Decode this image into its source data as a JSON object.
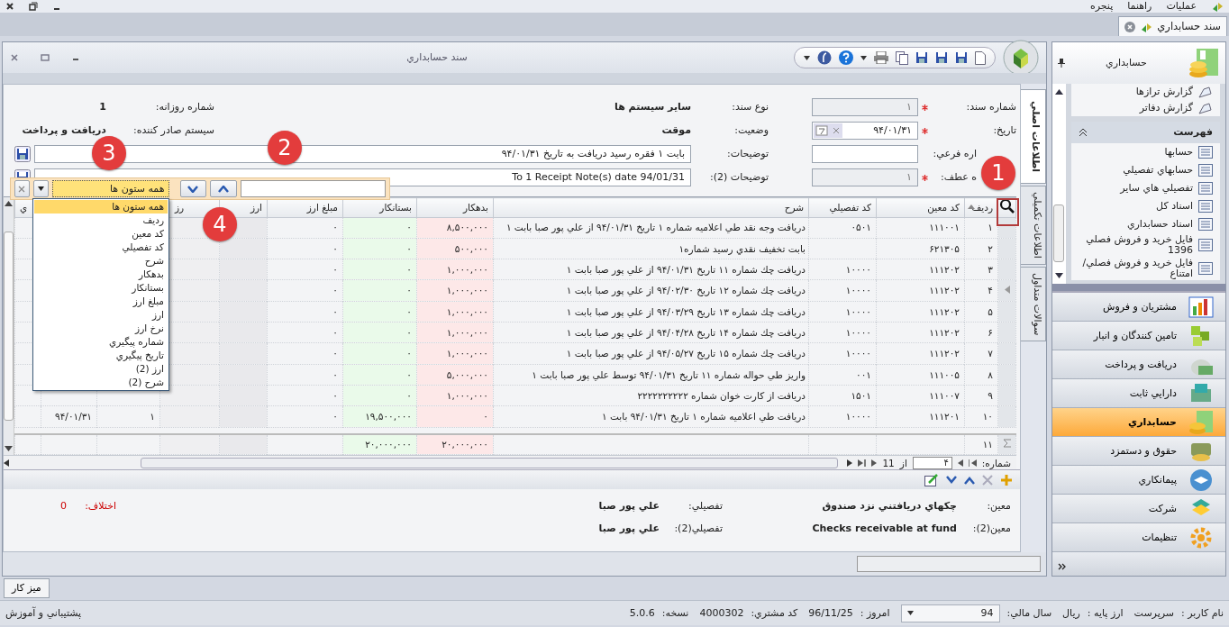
{
  "menubar": {
    "items": [
      "عمليات",
      "راهنما",
      "پنجره"
    ]
  },
  "doc_tabs": [
    {
      "label": "سند حسابداري",
      "selected": true
    }
  ],
  "window": {
    "title": "سند حسابداري"
  },
  "form": {
    "right": [
      {
        "label": "شماره سند:",
        "required": true,
        "value": "۱",
        "disabled": true,
        "kind": "field"
      },
      {
        "label": "تاريخ:",
        "required": true,
        "value": "۹۴/۰۱/۳۱",
        "disabled": false,
        "kind": "date"
      },
      {
        "label": "اره فرعي:",
        "required": false,
        "disabled": false,
        "kind": "field"
      },
      {
        "label": "ه عطف:",
        "required": true,
        "value": "۱",
        "disabled": true,
        "kind": "field"
      }
    ],
    "middle": [
      {
        "label": "نوع سند:",
        "value": "ساير سيستم ها",
        "kind": "text"
      },
      {
        "label": "وضعيت:",
        "value": "موقت",
        "kind": "text"
      },
      {
        "label": "توضيحات:",
        "value": "بابت ۱ فقره رسيد دريافت به تاريخ ۹۴/۰۱/۳۱",
        "kind": "field"
      },
      {
        "label": "توضيحات (2):",
        "value": "To 1 Receipt Note(s) date 94/01/31",
        "kind": "field"
      }
    ],
    "left": [
      {
        "label": "شماره روزانه:",
        "value": "1"
      },
      {
        "label": "سيستم صادر كننده:",
        "value": "دريافت و پرداخت"
      }
    ]
  },
  "side_tabs": [
    {
      "label": "اطلاعات اصلي",
      "selected": true
    },
    {
      "label": "اطلاعات تكميلي",
      "selected": false
    },
    {
      "label": "سوالات متداول",
      "selected": false
    }
  ],
  "find_panel": {
    "combo_value": "همه ستون ها"
  },
  "column_dropdown": {
    "items": [
      {
        "label": "همه ستون ها",
        "selected": true
      },
      {
        "label": "رديف",
        "selected": false
      },
      {
        "label": "كد معين",
        "selected": false
      },
      {
        "label": "كد تفصيلي",
        "selected": false
      },
      {
        "label": "شرح",
        "selected": false
      },
      {
        "label": "بدهكار",
        "selected": false
      },
      {
        "label": "بستانكار",
        "selected": false
      },
      {
        "label": "مبلغ ارز",
        "selected": false
      },
      {
        "label": "ارز",
        "selected": false
      },
      {
        "label": "نرخ ارز",
        "selected": false
      },
      {
        "label": "شماره پيگيري",
        "selected": false
      },
      {
        "label": "تاريخ پيگيري",
        "selected": false
      },
      {
        "label": "ارز (2)",
        "selected": false
      },
      {
        "label": "شرح (2)",
        "selected": false
      }
    ]
  },
  "table": {
    "columns": [
      {
        "label": "رديف",
        "sorted": true
      },
      {
        "label": "كد معين",
        "sorted": false
      },
      {
        "label": "كد تفصيلي",
        "sorted": false
      },
      {
        "label": "شرح",
        "sorted": false
      },
      {
        "label": "بدهكار",
        "sorted": false
      },
      {
        "label": "بستانكار",
        "sorted": false
      },
      {
        "label": "مبلغ ارز",
        "sorted": false
      },
      {
        "label": "ارز",
        "sorted": false
      },
      {
        "label": "رز"
      },
      {},
      {},
      {
        "label": "ي",
        "sorted": false
      }
    ],
    "rows": [
      {
        "current": false,
        "cells": {
          "row": "۱",
          "account": "۱۱۱۰۰۱",
          "detail": "۰۵۰۱",
          "description": "دريافت وجه نقد طي اعلاميه شماره ۱ تاريخ ۹۴/۰۱/۳۱ از علي پور صبا بابت ۱",
          "debit": "۸,۵۰۰,۰۰۰",
          "credit": "۰",
          "fx_amount": "۰"
        }
      },
      {
        "current": false,
        "cells": {
          "row": "۲",
          "account": "۶۲۱۳۰۵",
          "description": "بابت تخفيف نقدي رسيد شماره۱",
          "debit": "۵۰۰,۰۰۰",
          "credit": "۰",
          "fx_amount": "۰"
        }
      },
      {
        "current": false,
        "cells": {
          "row": "۳",
          "account": "۱۱۱۲۰۲",
          "detail": "۱۰۰۰۰",
          "description": "دريافت چك شماره ۱۱ تاريخ ۹۴/۰۱/۳۱ از علي پور صبا بابت ۱",
          "debit": "۱,۰۰۰,۰۰۰",
          "credit": "۰",
          "fx_amount": "۰"
        }
      },
      {
        "current": true,
        "cells": {
          "row": "۴",
          "account": "۱۱۱۲۰۲",
          "detail": "۱۰۰۰۰",
          "description": "دريافت چك شماره ۱۲ تاريخ ۹۴/۰۲/۳۰ از علي پور صبا بابت ۱",
          "debit": "۱,۰۰۰,۰۰۰",
          "credit": "۰",
          "fx_amount": "۰"
        }
      },
      {
        "current": false,
        "cells": {
          "row": "۵",
          "account": "۱۱۱۲۰۲",
          "detail": "۱۰۰۰۰",
          "description": "دريافت چك شماره ۱۳ تاريخ ۹۴/۰۳/۲۹ از علي پور صبا بابت ۱",
          "debit": "۱,۰۰۰,۰۰۰",
          "credit": "۰",
          "fx_amount": "۰"
        }
      },
      {
        "current": false,
        "cells": {
          "row": "۶",
          "account": "۱۱۱۲۰۲",
          "detail": "۱۰۰۰۰",
          "description": "دريافت چك شماره ۱۴ تاريخ ۹۴/۰۴/۲۸ از علي پور صبا بابت ۱",
          "debit": "۱,۰۰۰,۰۰۰",
          "credit": "۰",
          "fx_amount": "۰"
        }
      },
      {
        "current": false,
        "cells": {
          "row": "۷",
          "account": "۱۱۱۲۰۲",
          "detail": "۱۰۰۰۰",
          "description": "دريافت چك شماره ۱۵ تاريخ ۹۴/۰۵/۲۷ از علي پور صبا بابت ۱",
          "debit": "۱,۰۰۰,۰۰۰",
          "credit": "۰",
          "fx_amount": "۰"
        }
      },
      {
        "current": false,
        "cells": {
          "row": "۸",
          "account": "۱۱۱۰۰۵",
          "detail": "۰۰۱",
          "description": "واريز طي حواله شماره ۱۱ تاريخ ۹۴/۰۱/۳۱ توسط علي پور صبا بابت ۱",
          "debit": "۵,۰۰۰,۰۰۰",
          "credit": "۰",
          "fx_amount": "۰"
        }
      },
      {
        "current": false,
        "cells": {
          "row": "۹",
          "account": "۱۱۱۰۰۷",
          "detail": "۱۵۰۱",
          "description": "دريافت از كارت خوان شماره ۲۲۲۲۲۲۲۲۲۲",
          "debit": "۱,۰۰۰,۰۰۰",
          "credit": "۰",
          "fx_amount": "۰"
        }
      },
      {
        "current": false,
        "cells": {
          "row": "۱۰",
          "account": "۱۱۱۲۰۱",
          "detail": "۱۰۰۰۰",
          "description": "دريافت طي اعلاميه شماره ۱ تاريخ ۹۴/۰۱/۳۱ بابت ۱",
          "debit": "۰",
          "credit": "۱۹,۵۰۰,۰۰۰",
          "fx_amount": "۰",
          "column_10": "۱",
          "column_11": "۹۴/۰۱/۳۱"
        }
      }
    ],
    "summary": {
      "row": "۱۱",
      "debit": "۲۰,۰۰۰,۰۰۰",
      "credit": "۲۰,۰۰۰,۰۰۰"
    }
  },
  "pager": {
    "label": "شماره:",
    "current": "۴",
    "of": "از",
    "total": "11"
  },
  "details": {
    "items": [
      {
        "label": "معين:",
        "value": "چكهاي دريافتني نزد صندوق"
      },
      {
        "label": "تفصيلي:",
        "value": "علي پور صبا"
      },
      {
        "label": "معين(2):",
        "value": "Checks receivable at fund"
      },
      {
        "label": "تفصيلي(2):",
        "value": "علي پور صبا"
      }
    ],
    "difference": {
      "label": "اختلاف:",
      "value": "0"
    }
  },
  "sidebar": {
    "title": "حسابداري",
    "links": [
      "گزارش ترازها",
      "گزارش دفاتر"
    ],
    "group": {
      "title": "فهرست",
      "expanded": true,
      "items": [
        "حسابها",
        "حسابهاي تفصيلي",
        "تفصيلي هاي ساير",
        "اسناد كل",
        "اسناد حسابداري",
        "فايل خريد و فروش فصلي 1396",
        "فايل خريد و فروش فصلي/امتناع"
      ]
    },
    "modules": [
      {
        "label": "مشتريان و فروش",
        "selected": false
      },
      {
        "label": "تامين كنندگان و انبار",
        "selected": false
      },
      {
        "label": "دريافت و پرداخت",
        "selected": false
      },
      {
        "label": "دارايي ثابت",
        "selected": false
      },
      {
        "label": "حسابداري",
        "selected": true
      },
      {
        "label": "حقوق و دستمزد",
        "selected": false
      },
      {
        "label": "پيمانكاري",
        "selected": false
      },
      {
        "label": "شركت",
        "selected": false
      },
      {
        "label": "تنظيمات",
        "selected": false
      }
    ]
  },
  "desk_button": "ميز كار",
  "status_bar": {
    "items": [
      {
        "label": "نام كاربر :",
        "value": "سرپرست"
      },
      {
        "label": "ارز پايه :",
        "value": "ريال"
      },
      {
        "label": "سال مالي:",
        "value": "94",
        "kind": "select"
      },
      {
        "label": "امروز :",
        "value": "96/11/25"
      },
      {
        "label": "كد مشتري:",
        "value": "4000302"
      },
      {
        "label": "نسخه:",
        "value": "5.0.6"
      }
    ],
    "link": "پشتيباني و آموزش"
  },
  "annotations": [
    {
      "label": "1"
    },
    {
      "label": "2"
    },
    {
      "label": "3"
    },
    {
      "label": "4"
    }
  ]
}
